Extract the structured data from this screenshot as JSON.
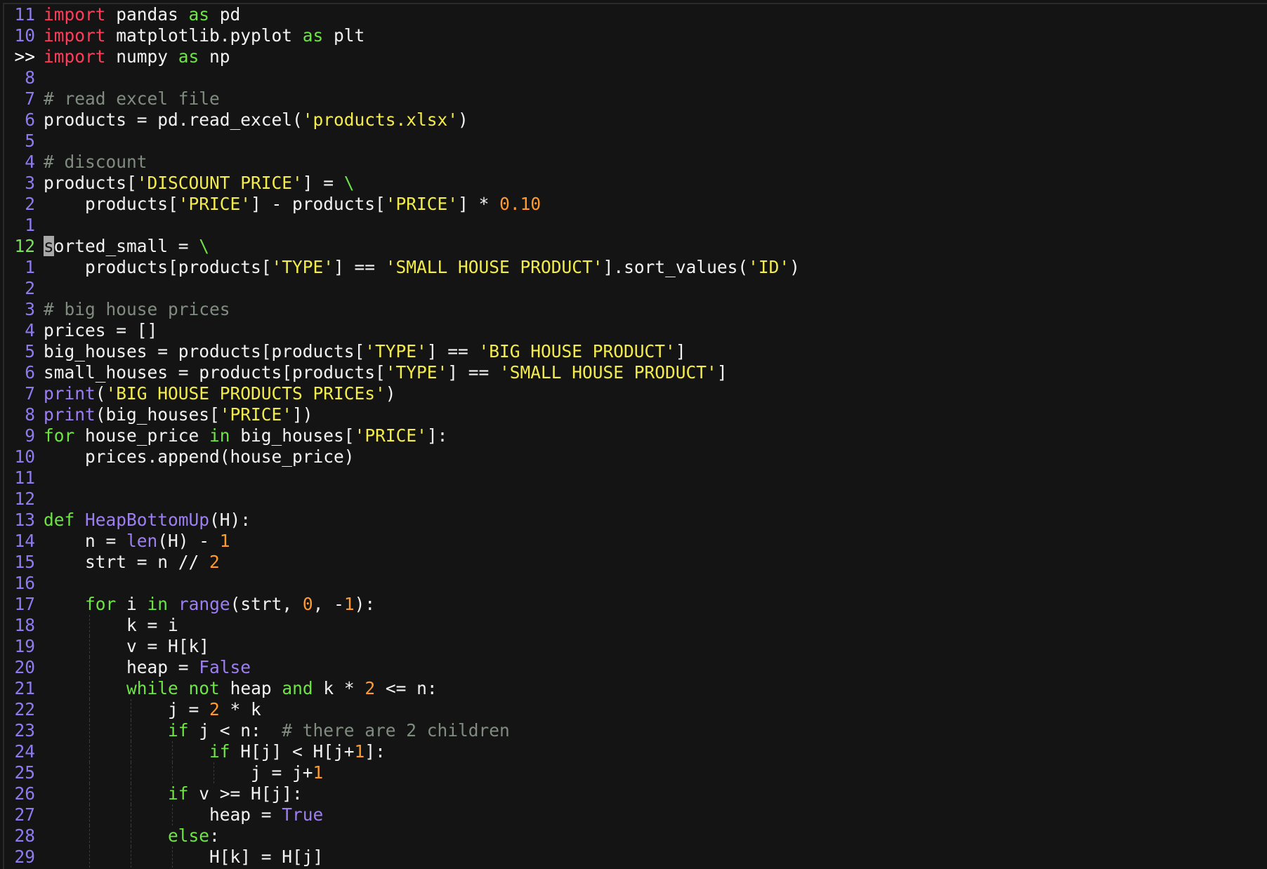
{
  "editor": {
    "colors": {
      "background": "#141414",
      "line_number": "#8f7bf0",
      "current_line_number": "#79e05b",
      "import_keyword": "#ff3d5a",
      "keyword": "#6ee445",
      "string": "#f3ec4a",
      "number": "#ff9a2e",
      "comment": "#808c80",
      "builtin": "#9d7ff2",
      "text": "#f2f2f2"
    },
    "cursor": {
      "line": "12",
      "char": "s"
    },
    "lines": [
      {
        "num": "11",
        "tokens": [
          {
            "t": "import",
            "c": "kw-red"
          },
          {
            "t": " pandas "
          },
          {
            "t": "as",
            "c": "kw-green"
          },
          {
            "t": " pd"
          }
        ]
      },
      {
        "num": "10",
        "tokens": [
          {
            "t": "import",
            "c": "kw-red"
          },
          {
            "t": " matplotlib.pyplot "
          },
          {
            "t": "as",
            "c": "kw-green"
          },
          {
            "t": " plt"
          }
        ]
      },
      {
        "num": ">>",
        "gutter": "marker",
        "tokens": [
          {
            "t": "import",
            "c": "kw-red"
          },
          {
            "t": " numpy "
          },
          {
            "t": "as",
            "c": "kw-green"
          },
          {
            "t": " np"
          }
        ]
      },
      {
        "num": "8",
        "tokens": []
      },
      {
        "num": "7",
        "tokens": [
          {
            "t": "# read excel file",
            "c": "cmt"
          }
        ]
      },
      {
        "num": "6",
        "tokens": [
          {
            "t": "products = pd.read_excel("
          },
          {
            "t": "'products.xlsx'",
            "c": "str"
          },
          {
            "t": ")"
          }
        ]
      },
      {
        "num": "5",
        "tokens": []
      },
      {
        "num": "4",
        "tokens": [
          {
            "t": "# discount",
            "c": "cmt"
          }
        ]
      },
      {
        "num": "3",
        "tokens": [
          {
            "t": "products["
          },
          {
            "t": "'DISCOUNT PRICE'",
            "c": "str"
          },
          {
            "t": "] = "
          },
          {
            "t": "\\",
            "c": "kw-green"
          }
        ]
      },
      {
        "num": "2",
        "tokens": [
          {
            "t": "    products["
          },
          {
            "t": "'PRICE'",
            "c": "str"
          },
          {
            "t": "] - products["
          },
          {
            "t": "'PRICE'",
            "c": "str"
          },
          {
            "t": "] * "
          },
          {
            "t": "0.10",
            "c": "num"
          }
        ]
      },
      {
        "num": "1",
        "tokens": []
      },
      {
        "num": "12",
        "gutter": "current",
        "tokens": [
          {
            "t": "s",
            "c": "cursor"
          },
          {
            "t": "orted_small = "
          },
          {
            "t": "\\",
            "c": "kw-green"
          }
        ]
      },
      {
        "num": "1",
        "tokens": [
          {
            "t": "    products[products["
          },
          {
            "t": "'TYPE'",
            "c": "str"
          },
          {
            "t": "] == "
          },
          {
            "t": "'SMALL HOUSE PRODUCT'",
            "c": "str"
          },
          {
            "t": "].sort_values("
          },
          {
            "t": "'ID'",
            "c": "str"
          },
          {
            "t": ")"
          }
        ]
      },
      {
        "num": "2",
        "tokens": []
      },
      {
        "num": "3",
        "tokens": [
          {
            "t": "# big house prices",
            "c": "cmt"
          }
        ]
      },
      {
        "num": "4",
        "tokens": [
          {
            "t": "prices = []"
          }
        ]
      },
      {
        "num": "5",
        "tokens": [
          {
            "t": "big_houses = products[products["
          },
          {
            "t": "'TYPE'",
            "c": "str"
          },
          {
            "t": "] == "
          },
          {
            "t": "'BIG HOUSE PRODUCT'",
            "c": "str"
          },
          {
            "t": "]"
          }
        ]
      },
      {
        "num": "6",
        "tokens": [
          {
            "t": "small_houses = products[products["
          },
          {
            "t": "'TYPE'",
            "c": "str"
          },
          {
            "t": "] == "
          },
          {
            "t": "'SMALL HOUSE PRODUCT'",
            "c": "str"
          },
          {
            "t": "]"
          }
        ]
      },
      {
        "num": "7",
        "tokens": [
          {
            "t": "print",
            "c": "builtin"
          },
          {
            "t": "("
          },
          {
            "t": "'BIG HOUSE PRODUCTS PRICEs'",
            "c": "str"
          },
          {
            "t": ")"
          }
        ]
      },
      {
        "num": "8",
        "tokens": [
          {
            "t": "print",
            "c": "builtin"
          },
          {
            "t": "(big_houses["
          },
          {
            "t": "'PRICE'",
            "c": "str"
          },
          {
            "t": "])"
          }
        ]
      },
      {
        "num": "9",
        "tokens": [
          {
            "t": "for",
            "c": "kw-green"
          },
          {
            "t": " house_price "
          },
          {
            "t": "in",
            "c": "kw-green"
          },
          {
            "t": " big_houses["
          },
          {
            "t": "'PRICE'",
            "c": "str"
          },
          {
            "t": "]:"
          }
        ]
      },
      {
        "num": "10",
        "tokens": [
          {
            "t": "    prices.append(house_price)"
          }
        ]
      },
      {
        "num": "11",
        "tokens": []
      },
      {
        "num": "12",
        "tokens": []
      },
      {
        "num": "13",
        "tokens": [
          {
            "t": "def",
            "c": "kw-green"
          },
          {
            "t": " "
          },
          {
            "t": "HeapBottomUp",
            "c": "builtin"
          },
          {
            "t": "(H):"
          }
        ]
      },
      {
        "num": "14",
        "tokens": [
          {
            "t": "    n = "
          },
          {
            "t": "len",
            "c": "builtin"
          },
          {
            "t": "(H) - "
          },
          {
            "t": "1",
            "c": "num"
          }
        ]
      },
      {
        "num": "15",
        "tokens": [
          {
            "t": "    strt = n // "
          },
          {
            "t": "2",
            "c": "num"
          }
        ]
      },
      {
        "num": "16",
        "tokens": []
      },
      {
        "num": "17",
        "tokens": [
          {
            "t": "    "
          },
          {
            "t": "for",
            "c": "kw-green"
          },
          {
            "t": " i "
          },
          {
            "t": "in",
            "c": "kw-green"
          },
          {
            "t": " "
          },
          {
            "t": "range",
            "c": "builtin"
          },
          {
            "t": "(strt, "
          },
          {
            "t": "0",
            "c": "num"
          },
          {
            "t": ", -"
          },
          {
            "t": "1",
            "c": "num"
          },
          {
            "t": "):"
          }
        ]
      },
      {
        "num": "18",
        "guides": 1,
        "tokens": [
          {
            "t": "        k = i"
          }
        ]
      },
      {
        "num": "19",
        "guides": 1,
        "tokens": [
          {
            "t": "        v = H[k]"
          }
        ]
      },
      {
        "num": "20",
        "guides": 1,
        "tokens": [
          {
            "t": "        heap = "
          },
          {
            "t": "False",
            "c": "builtin"
          }
        ]
      },
      {
        "num": "21",
        "guides": 1,
        "tokens": [
          {
            "t": "        "
          },
          {
            "t": "while",
            "c": "kw-green"
          },
          {
            "t": " "
          },
          {
            "t": "not",
            "c": "kw-green"
          },
          {
            "t": " heap "
          },
          {
            "t": "and",
            "c": "kw-green"
          },
          {
            "t": " k * "
          },
          {
            "t": "2",
            "c": "num"
          },
          {
            "t": " <= n:"
          }
        ]
      },
      {
        "num": "22",
        "guides": 2,
        "tokens": [
          {
            "t": "            j = "
          },
          {
            "t": "2",
            "c": "num"
          },
          {
            "t": " * k"
          }
        ]
      },
      {
        "num": "23",
        "guides": 2,
        "tokens": [
          {
            "t": "            "
          },
          {
            "t": "if",
            "c": "kw-green"
          },
          {
            "t": " j < n:  "
          },
          {
            "t": "# there are 2 children",
            "c": "cmt"
          }
        ]
      },
      {
        "num": "24",
        "guides": 3,
        "tokens": [
          {
            "t": "                "
          },
          {
            "t": "if",
            "c": "kw-green"
          },
          {
            "t": " H[j] < H[j+"
          },
          {
            "t": "1",
            "c": "num"
          },
          {
            "t": "]:"
          }
        ]
      },
      {
        "num": "25",
        "guides": 4,
        "tokens": [
          {
            "t": "                    j = j+"
          },
          {
            "t": "1",
            "c": "num"
          }
        ]
      },
      {
        "num": "26",
        "guides": 2,
        "tokens": [
          {
            "t": "            "
          },
          {
            "t": "if",
            "c": "kw-green"
          },
          {
            "t": " v >= H[j]:"
          }
        ]
      },
      {
        "num": "27",
        "guides": 3,
        "tokens": [
          {
            "t": "                heap = "
          },
          {
            "t": "True",
            "c": "builtin"
          }
        ]
      },
      {
        "num": "28",
        "guides": 2,
        "tokens": [
          {
            "t": "            "
          },
          {
            "t": "else",
            "c": "kw-green"
          },
          {
            "t": ":"
          }
        ]
      },
      {
        "num": "29",
        "guides": 3,
        "tokens": [
          {
            "t": "                H[k] = H[j]"
          }
        ]
      }
    ]
  }
}
